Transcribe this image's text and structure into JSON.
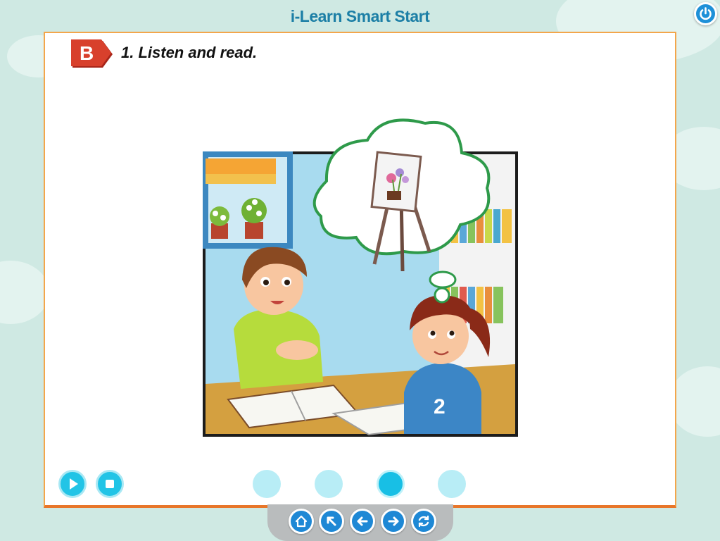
{
  "app": {
    "title": "i-Learn Smart Start"
  },
  "section": {
    "badge": "B",
    "instruction": "1. Listen and read."
  },
  "player": {
    "slides": 4,
    "active_slide": 3
  },
  "colors": {
    "accent": "#1e88d5",
    "panel_border": "#f3a64b",
    "badge": "#d63a2a",
    "control": "#22c4e6"
  },
  "icons": {
    "top_right": "power-icon",
    "player": [
      "play-icon",
      "stop-icon"
    ],
    "nav": [
      "home-icon",
      "back-arrow-icon",
      "previous-icon",
      "next-icon",
      "refresh-icon"
    ]
  }
}
